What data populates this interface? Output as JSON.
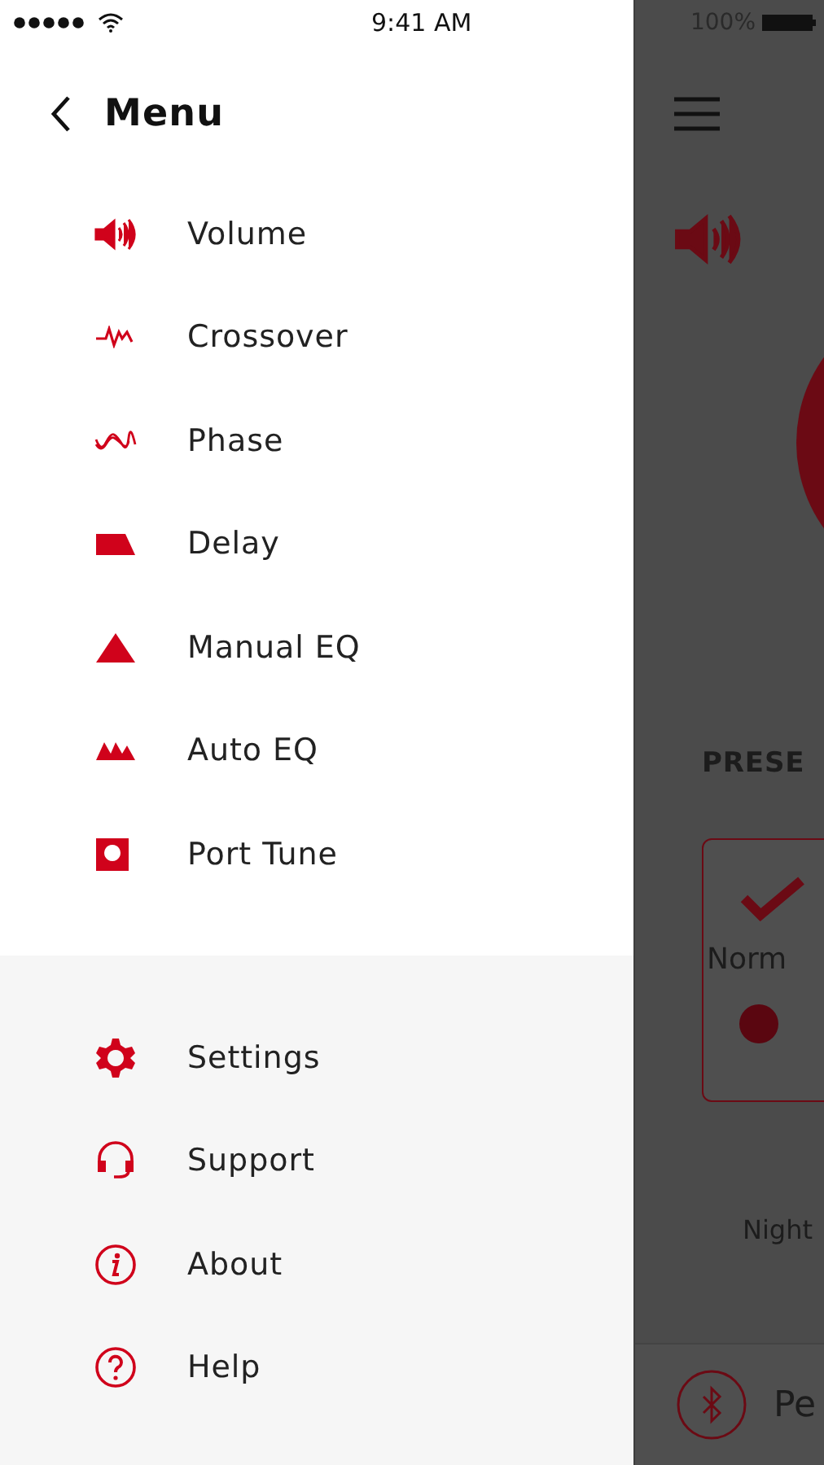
{
  "status_bar": {
    "time": "9:41 AM",
    "battery": "100%"
  },
  "drawer": {
    "title": "Menu",
    "items": [
      {
        "label": "Volume"
      },
      {
        "label": "Crossover"
      },
      {
        "label": "Phase"
      },
      {
        "label": "Delay"
      },
      {
        "label": "Manual EQ"
      },
      {
        "label": "Auto EQ"
      },
      {
        "label": "Port Tune"
      }
    ],
    "footer_items": [
      {
        "label": "Settings"
      },
      {
        "label": "Support"
      },
      {
        "label": "About"
      },
      {
        "label": "Help"
      }
    ]
  },
  "background_screen": {
    "presets_heading": "PRESE",
    "preset_card": {
      "label": "Norm",
      "selected": true
    },
    "preset_2": "Night",
    "device": "Pe"
  }
}
